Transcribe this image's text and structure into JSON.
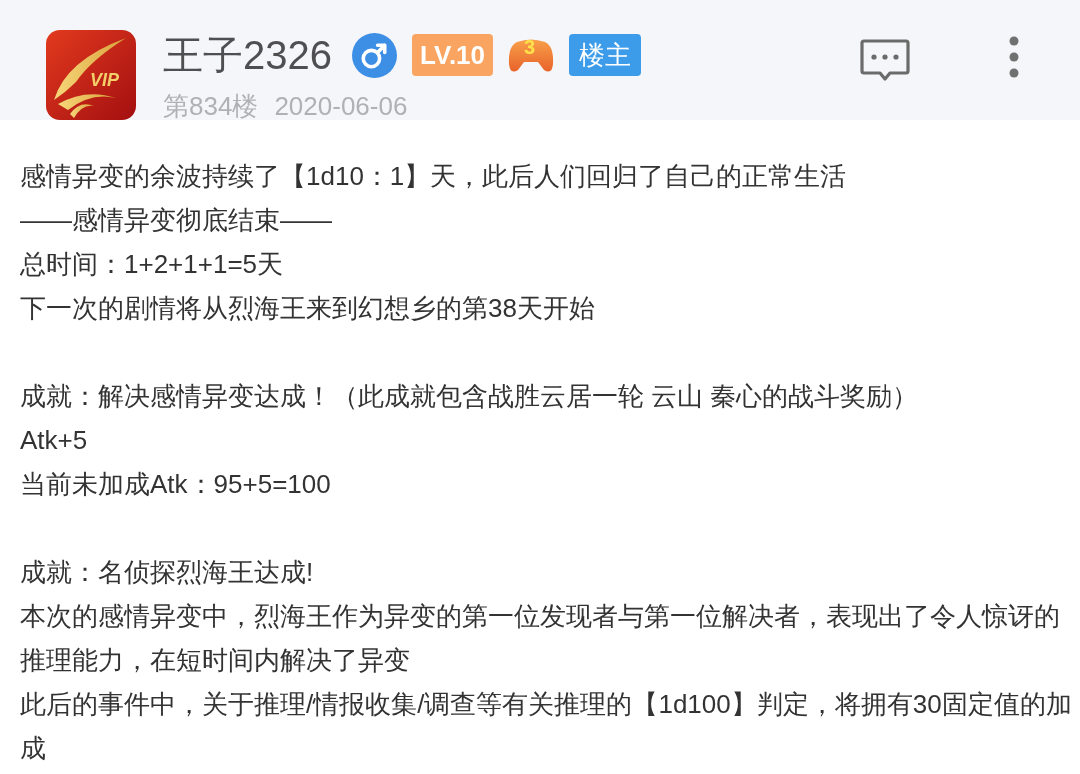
{
  "post_header": {
    "avatar_text": "VIP",
    "username": "王子2326",
    "level_badge": "LV.10",
    "game_badge_number": "3",
    "role_badge": "楼主",
    "floor": "第834楼",
    "date": "2020-06-06"
  },
  "body": {
    "sections": [
      {
        "lines": [
          "感情异变的余波持续了【1d10：1】天，此后人们回归了自己的正常生活",
          "——感情异变彻底结束——",
          "总时间：1+2+1+1=5天",
          "下一次的剧情将从烈海王来到幻想乡的第38天开始"
        ]
      },
      {
        "lines": [
          "成就：解决感情异变达成！（此成就包含战胜云居一轮 云山 秦心的战斗奖励）",
          "Atk+5",
          "当前未加成Atk：95+5=100"
        ]
      },
      {
        "lines": [
          "成就：名侦探烈海王达成!",
          "本次的感情异变中，烈海王作为异变的第一位发现者与第一位解决者，表现出了令人惊讶的推理能力，在短时间内解决了异变",
          "此后的事件中，关于推理/情报收集/调查等有关推理的【1d100】判定，将拥有30固定值的加成"
        ]
      }
    ]
  }
}
